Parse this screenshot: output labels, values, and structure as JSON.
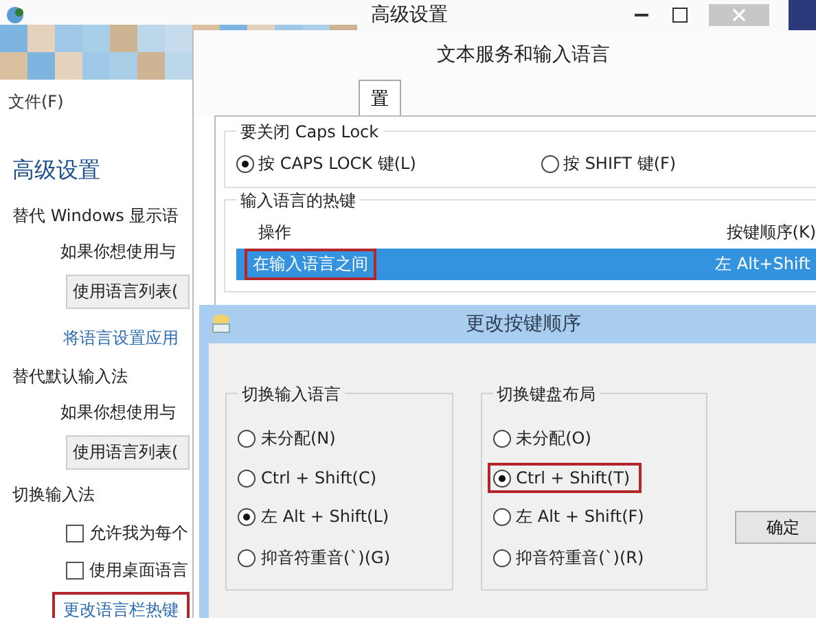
{
  "main_window": {
    "title": "高级设置",
    "menu": [
      "文件(F)"
    ],
    "sidebar": [
      {
        "kind": "heading",
        "text": "高级设置"
      },
      {
        "kind": "section",
        "text": "替代 Windows 显示语"
      },
      {
        "kind": "text",
        "text": "如果你想使用与"
      },
      {
        "kind": "dropdown",
        "text": "使用语言列表("
      },
      {
        "kind": "link",
        "text": "将语言设置应用",
        "highlighted": false
      },
      {
        "kind": "section",
        "text": "替代默认输入法"
      },
      {
        "kind": "text",
        "text": "如果你想使用与"
      },
      {
        "kind": "dropdown",
        "text": "使用语言列表("
      },
      {
        "kind": "section",
        "text": "切换输入法"
      },
      {
        "kind": "checkbox",
        "text": "允许我为每个",
        "checked": false
      },
      {
        "kind": "checkbox",
        "text": "使用桌面语言",
        "checked": false
      },
      {
        "kind": "link",
        "text": "更改语言栏热键",
        "highlighted": true
      }
    ]
  },
  "services_window": {
    "title": "文本服务和输入语言",
    "tabs": [
      {
        "label": "置",
        "selected": true
      }
    ],
    "caps_lock": {
      "title": "要关闭 Caps Lock",
      "options": [
        {
          "label": "按 CAPS LOCK 键(L)",
          "selected": true
        },
        {
          "label": "按 SHIFT 键(F)",
          "selected": false
        }
      ]
    },
    "hotkeys": {
      "title": "输入语言的热键",
      "columns": [
        "操作",
        "按键顺序(K)"
      ],
      "rows": [
        {
          "action": "在输入语言之间",
          "keys": "左 Alt+Shift",
          "selected": true,
          "highlighted": true
        }
      ]
    }
  },
  "dialog": {
    "title": "更改按键顺序",
    "groups": [
      {
        "title": "切换输入语言",
        "options": [
          {
            "label": "未分配(N)",
            "selected": false,
            "highlighted": false
          },
          {
            "label": "Ctrl + Shift(C)",
            "selected": false,
            "highlighted": false
          },
          {
            "label": "左 Alt + Shift(L)",
            "selected": true,
            "highlighted": false
          },
          {
            "label": "抑音符重音(`)(G)",
            "selected": false,
            "highlighted": false
          }
        ]
      },
      {
        "title": "切换键盘布局",
        "options": [
          {
            "label": "未分配(O)",
            "selected": false,
            "highlighted": false
          },
          {
            "label": "Ctrl + Shift(T)",
            "selected": true,
            "highlighted": true
          },
          {
            "label": "左 Alt + Shift(F)",
            "selected": false,
            "highlighted": false
          },
          {
            "label": "抑音符重音(`)(R)",
            "selected": false,
            "highlighted": false
          }
        ]
      }
    ],
    "ok_button": "确定"
  }
}
